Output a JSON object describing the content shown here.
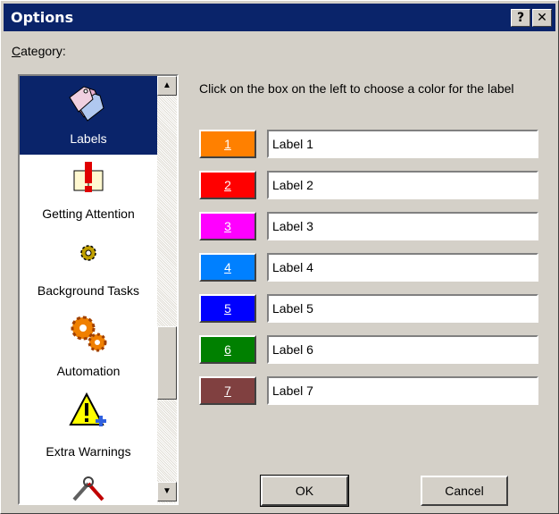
{
  "window": {
    "title": "Options",
    "help_btn": "?",
    "close_btn": "✕"
  },
  "category_label_prefix": "C",
  "category_label_rest": "ategory:",
  "categories": [
    {
      "label": "Labels",
      "icon": "labels-tags-icon",
      "selected": true
    },
    {
      "label": "Getting Attention",
      "icon": "exclamation-book-icon"
    },
    {
      "label": "Background Tasks",
      "icon": "gear-small-icon"
    },
    {
      "label": "Automation",
      "icon": "orange-gears-icon"
    },
    {
      "label": "Extra Warnings",
      "icon": "warning-plus-icon"
    },
    {
      "label": "",
      "icon": "tools-icon"
    }
  ],
  "instruction": "Click on the box on the left to choose a color for the label",
  "label_rows": [
    {
      "num": "1",
      "value": "Label 1",
      "color": "#ff8000"
    },
    {
      "num": "2",
      "value": "Label 2",
      "color": "#ff0000"
    },
    {
      "num": "3",
      "value": "Label 3",
      "color": "#ff00ff"
    },
    {
      "num": "4",
      "value": "Label 4",
      "color": "#0080ff"
    },
    {
      "num": "5",
      "value": "Label 5",
      "color": "#0000ff"
    },
    {
      "num": "6",
      "value": "Label 6",
      "color": "#008000"
    },
    {
      "num": "7",
      "value": "Label 7",
      "color": "#804040"
    }
  ],
  "buttons": {
    "ok": "OK",
    "cancel": "Cancel"
  },
  "scroll": {
    "up": "▲",
    "down": "▼"
  }
}
